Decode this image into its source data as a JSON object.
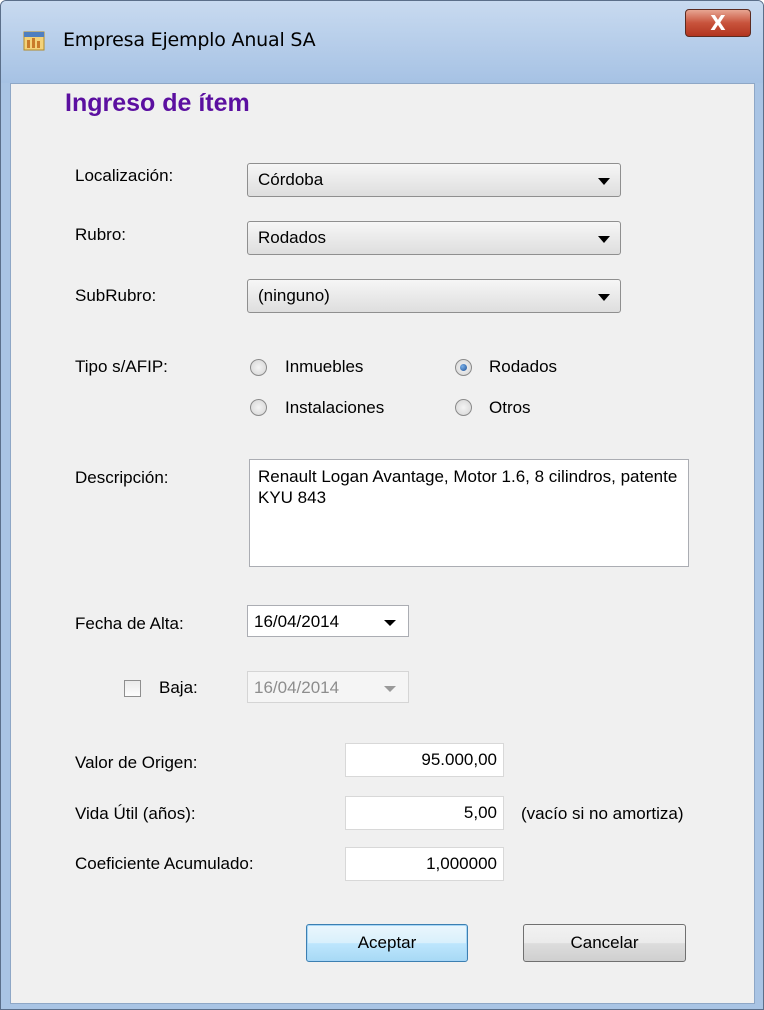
{
  "window": {
    "title": "Empresa Ejemplo Anual SA",
    "close_label": "X"
  },
  "form": {
    "title": "Ingreso de ítem",
    "localizacion": {
      "label": "Localización:",
      "value": "Córdoba"
    },
    "rubro": {
      "label": "Rubro:",
      "value": "Rodados"
    },
    "subrubro": {
      "label": "SubRubro:",
      "value": "(ninguno)"
    },
    "tipo": {
      "label": "Tipo s/AFIP:",
      "options": [
        "Inmuebles",
        "Rodados",
        "Instalaciones",
        "Otros"
      ],
      "selected": "Rodados"
    },
    "descripcion": {
      "label": "Descripción:",
      "value": "Renault Logan Avantage, Motor 1.6, 8 cilindros, patente KYU 843"
    },
    "fecha_alta": {
      "label": "Fecha de Alta:",
      "value": "16/04/2014"
    },
    "baja": {
      "label": "Baja:",
      "checked": false,
      "value": "16/04/2014"
    },
    "valor_origen": {
      "label": "Valor de Origen:",
      "value": "95.000,00"
    },
    "vida_util": {
      "label": "Vida Útil (años):",
      "value": "5,00",
      "hint": "(vacío si no amortiza)"
    },
    "coeficiente": {
      "label": "Coeficiente Acumulado:",
      "value": "1,000000"
    }
  },
  "buttons": {
    "accept": "Aceptar",
    "cancel": "Cancelar"
  },
  "colors": {
    "form_title": "#5b0fa0",
    "close_button": "#c8533c",
    "titlebar": "#a6c2e4"
  }
}
